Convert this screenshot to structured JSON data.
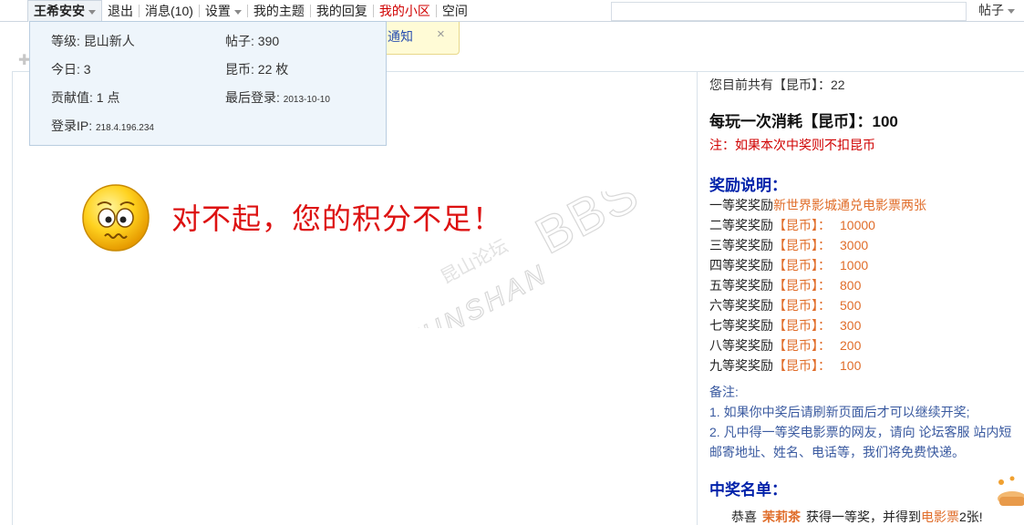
{
  "topbar": {
    "user": "王希安安",
    "logout": "退出",
    "messages": "消息(10)",
    "settings": "设置",
    "my_topics": "我的主题",
    "my_replies": "我的回复",
    "my_community": "我的小区",
    "space": "空间",
    "search_type": "帖子"
  },
  "notice": {
    "label": "通知",
    "close": "×"
  },
  "user_dropdown": {
    "level": "等级: 昆山新人",
    "posts": "帖子: 390",
    "today": "今日: 3",
    "coins": "昆币: 22 枚",
    "contribution": "贡献值: 1 点",
    "last_login_label": "最后登录: ",
    "last_login_value": "2013-10-10",
    "ip_label": "登录IP: ",
    "ip_value": "218.4.196.234"
  },
  "error": {
    "message": "对不起，您的积分不足！"
  },
  "watermark": {
    "top": "昆山论坛",
    "bottom": "KUNSHAN",
    "big": "BBS"
  },
  "sidebar": {
    "balance": "您目前共有【昆币】：22",
    "cost_label": "每玩一次消耗【昆币】：",
    "cost_value": "100",
    "cost_note": "注：如果本次中奖则不扣昆币",
    "rewards_title": "奖励说明：",
    "first_prize_label": "一等奖奖励",
    "first_prize_value": "新世界影城通兑电影票两张",
    "prizes": [
      {
        "label": "二等奖奖励",
        "coin": "【昆币】：",
        "amount": "10000"
      },
      {
        "label": "三等奖奖励",
        "coin": "【昆币】：",
        "amount": "3000"
      },
      {
        "label": "四等奖奖励",
        "coin": "【昆币】：",
        "amount": "1000"
      },
      {
        "label": "五等奖奖励",
        "coin": "【昆币】：",
        "amount": "800"
      },
      {
        "label": "六等奖奖励",
        "coin": "【昆币】：",
        "amount": "500"
      },
      {
        "label": "七等奖奖励",
        "coin": "【昆币】：",
        "amount": "300"
      },
      {
        "label": "八等奖奖励",
        "coin": "【昆币】：",
        "amount": "200"
      },
      {
        "label": "九等奖奖励",
        "coin": "【昆币】：",
        "amount": "100"
      }
    ],
    "notes_title": "备注:",
    "note_1": "1. 如果你中奖后请刷新页面后才可以继续开奖;",
    "note_2": "2. 凡中得一等奖电影票的网友，请向 论坛客服 站内短",
    "note_3": "邮寄地址、姓名、电话等，我们将免费快递。",
    "winners_title": "中奖名单：",
    "winner_prefix": "恭喜",
    "winner_name": "茉莉茶",
    "winner_middle": "获得一等奖，并得到",
    "winner_prize": "电影票",
    "winner_suffix": "2张!"
  }
}
